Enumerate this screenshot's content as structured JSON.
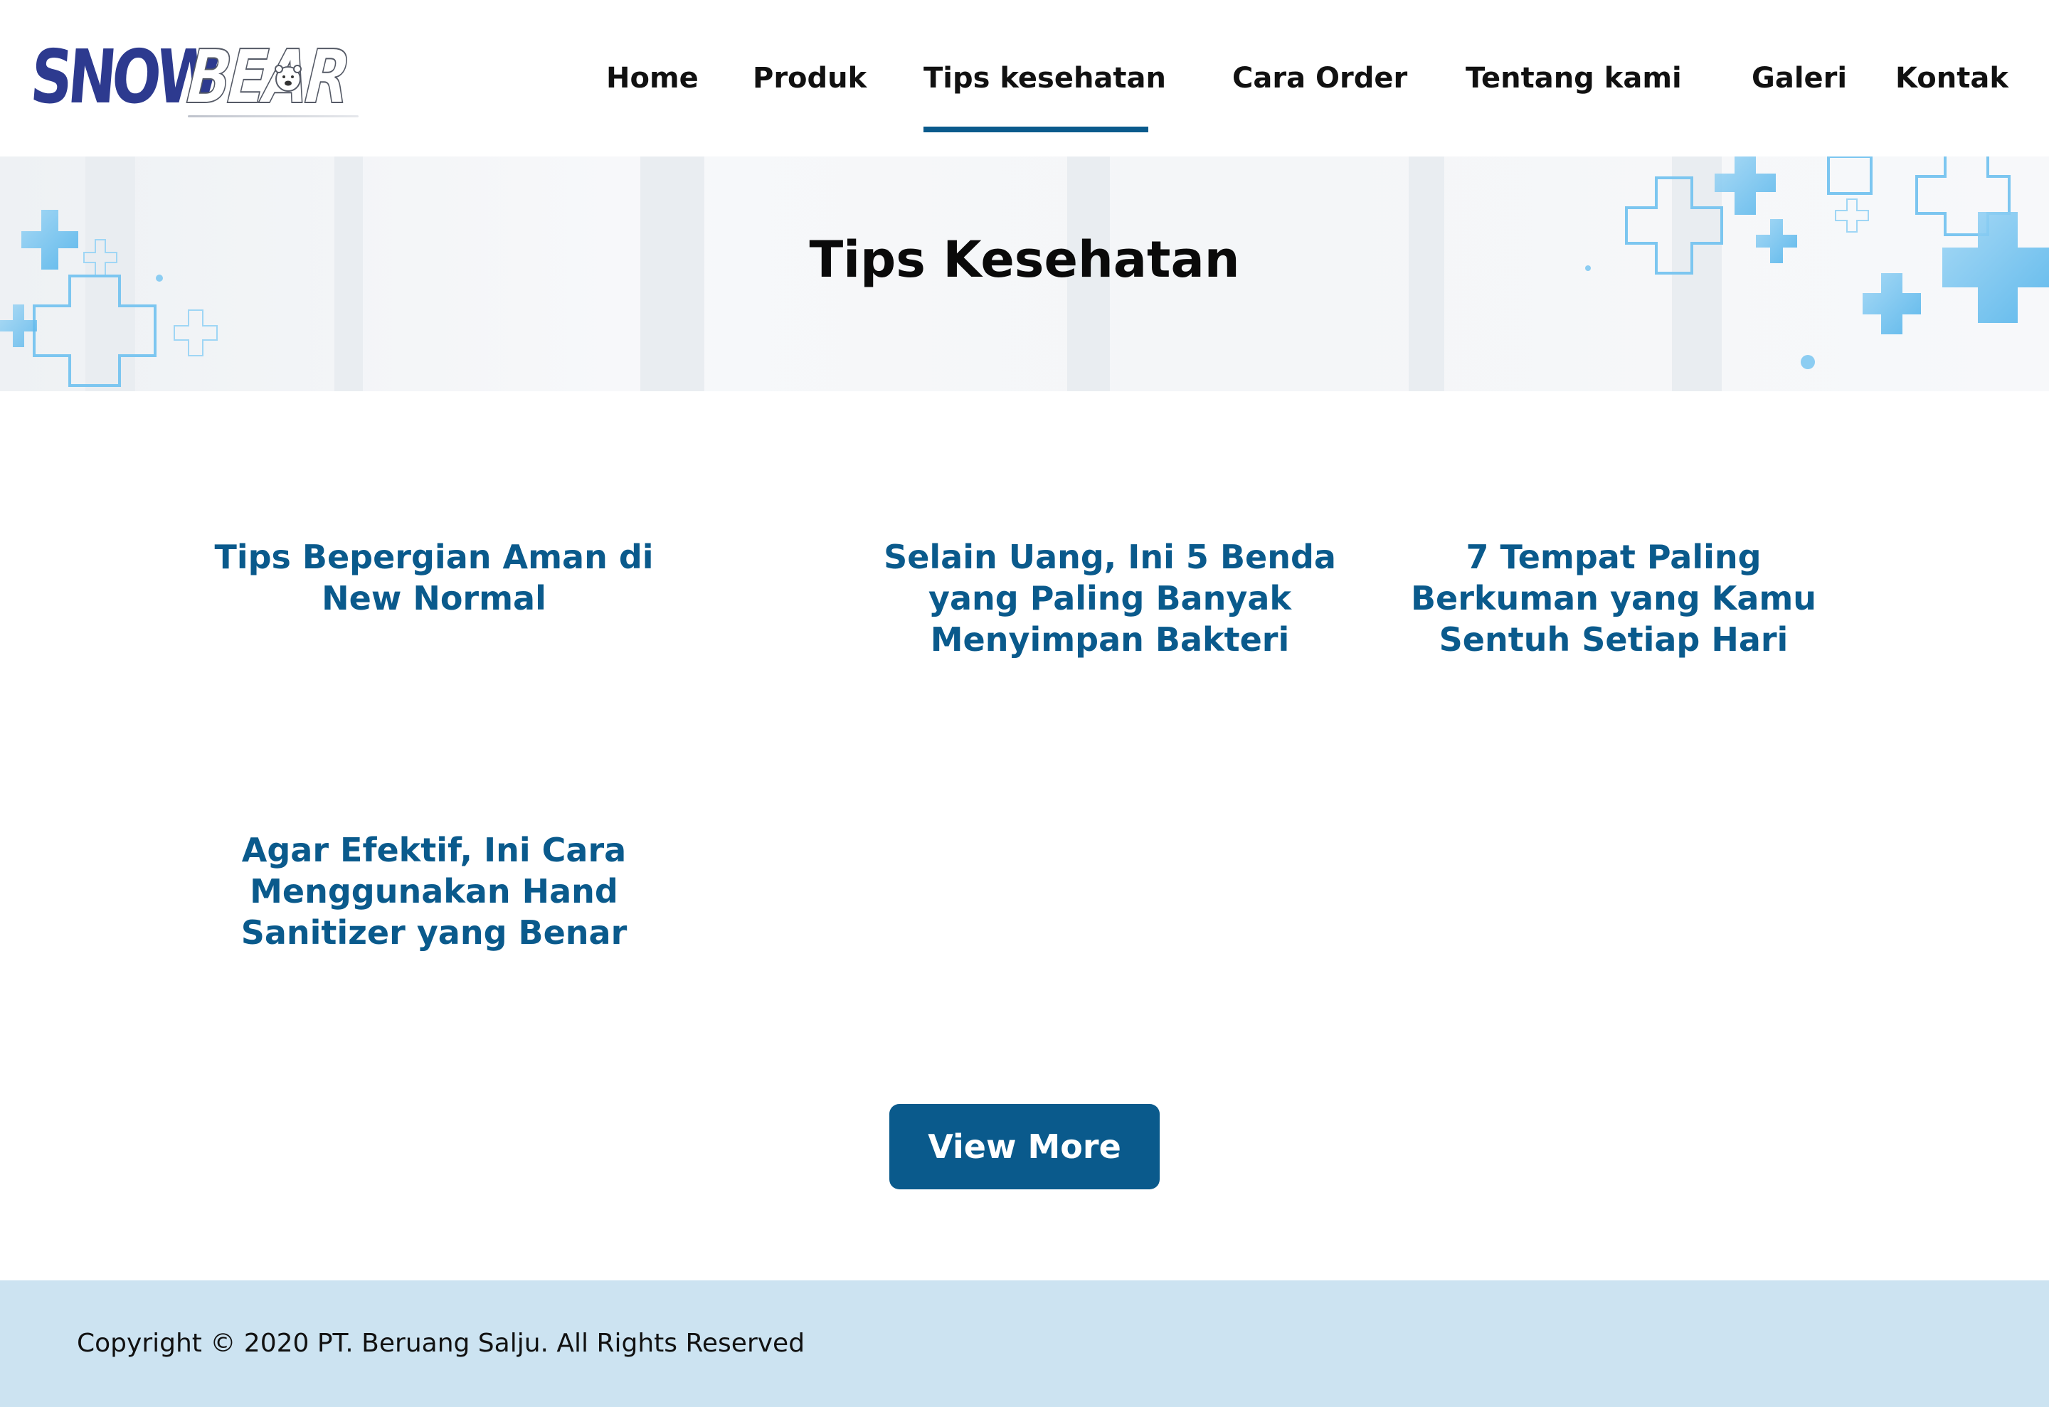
{
  "brand": {
    "name_part1": "SNOW",
    "name_part2": "BEAR"
  },
  "nav": {
    "items": [
      {
        "label": "Home"
      },
      {
        "label": "Produk"
      },
      {
        "label": "Tips kesehatan",
        "active": true
      },
      {
        "label": "Cara Order"
      },
      {
        "label": "Tentang kami"
      },
      {
        "label": "Galeri"
      },
      {
        "label": "Kontak"
      }
    ]
  },
  "hero": {
    "title": "Tips Kesehatan",
    "decoration": "medical-cross-icons"
  },
  "articles": [
    {
      "title": "Tips Bepergian Aman di New Normal"
    },
    {
      "title": "Selain Uang, Ini 5 Benda yang Paling Banyak Menyimpan Bakteri"
    },
    {
      "title": "7 Tempat Paling Berkuman yang Kamu Sentuh Setiap Hari"
    },
    {
      "title": "Agar Efektif, Ini Cara Menggunakan Hand Sanitizer yang Benar"
    }
  ],
  "view_more_label": "View More",
  "footer": {
    "copyright": "Copyright © 2020 PT. Beruang Salju. All Rights Reserved"
  },
  "colors": {
    "accent": "#0a5a8c",
    "logo_blue": "#2d3a8f",
    "footer_bg": "#cce3f1",
    "cross_blue": "#5bb8ec"
  }
}
